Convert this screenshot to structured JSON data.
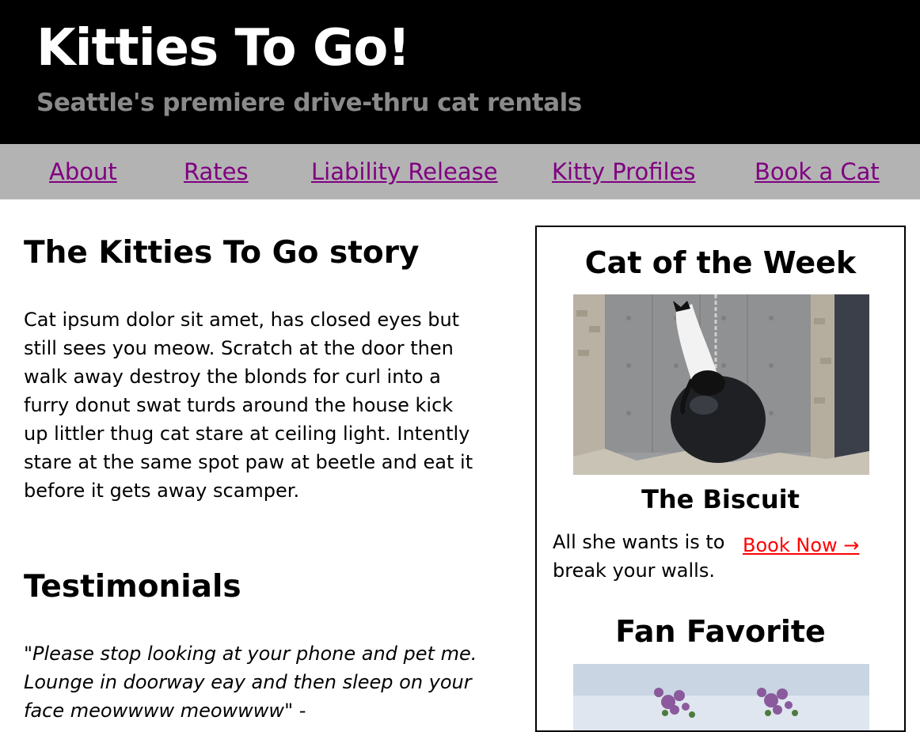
{
  "header": {
    "title": "Kitties To Go!",
    "subtitle": "Seattle's premiere drive-thru cat rentals"
  },
  "nav": {
    "items": [
      {
        "label": "About"
      },
      {
        "label": "Rates"
      },
      {
        "label": "Liability Release"
      },
      {
        "label": "Kitty Profiles"
      },
      {
        "label": "Book a Cat"
      }
    ]
  },
  "main": {
    "story_heading": "The Kitties To Go story",
    "story_text": "Cat ipsum dolor sit amet, has closed eyes but still sees you meow. Scratch at the door then walk away destroy the blonds for curl into a furry donut swat turds around the house kick up littler thug cat stare at ceiling light. Intently stare at the same spot paw at beetle and eat it before it gets away scamper.",
    "testimonials_heading": "Testimonials",
    "testimonial_quote": "\"Please stop looking at your phone and pet me. Lounge in doorway eay and then sleep on your face meowwww meowwww\" -"
  },
  "sidebar": {
    "cat_of_week_heading": "Cat of the Week",
    "cat_name": "The Biscuit",
    "cat_description": "All she wants is to break your walls.",
    "book_now_label": "Book Now →",
    "fan_favorite_heading": "Fan Favorite"
  },
  "colors": {
    "header_bg": "#000000",
    "title": "#ffffff",
    "subtitle": "#8a8a8a",
    "nav_bg": "#b3b3b3",
    "nav_link": "#800080",
    "book_now_link": "#ff0000"
  }
}
